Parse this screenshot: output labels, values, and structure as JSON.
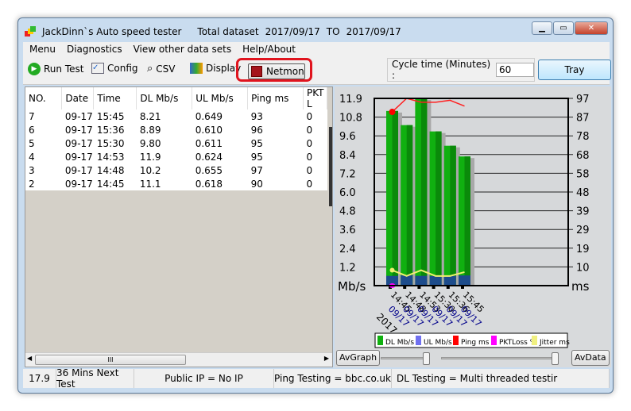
{
  "window": {
    "title": "JackDinn`s Auto speed tester",
    "dataset_label": "Total dataset",
    "date_from": "2017/09/17",
    "to_label": "TO",
    "date_to": "2017/09/17"
  },
  "menu": [
    "Menu",
    "Diagnostics",
    "View other data sets",
    "Help/About"
  ],
  "toolbar": {
    "run_test": "Run Test",
    "config": "Config",
    "csv": "CSV",
    "display": "Display",
    "netmon": "Netmon",
    "cycle_label": "Cycle time (Minutes) :",
    "cycle_value": "60",
    "tray": "Tray"
  },
  "table": {
    "headers": [
      "NO.",
      "Date",
      "Time",
      "DL Mb/s",
      "UL Mb/s",
      "Ping ms",
      "PKT L"
    ],
    "rows": [
      [
        "7",
        "09-17",
        "15:45",
        "8.21",
        "0.649",
        "93",
        "0"
      ],
      [
        "6",
        "09-17",
        "15:36",
        "8.89",
        "0.610",
        "96",
        "0"
      ],
      [
        "5",
        "09-17",
        "15:30",
        "9.80",
        "0.611",
        "95",
        "0"
      ],
      [
        "4",
        "09-17",
        "14:53",
        "11.9",
        "0.624",
        "95",
        "0"
      ],
      [
        "3",
        "09-17",
        "14:48",
        "10.2",
        "0.655",
        "97",
        "0"
      ],
      [
        "2",
        "09-17",
        "14:45",
        "11.1",
        "0.618",
        "90",
        "0"
      ]
    ],
    "scroll_thumb": "III"
  },
  "chart_data": {
    "type": "bar",
    "categories": [
      "14:45 09/17",
      "14:48 09/17",
      "14:53 09/17",
      "15:30 09/17",
      "15:36 09/17",
      "15:45 09/17"
    ],
    "times": [
      "14:45",
      "14:48",
      "14:53",
      "15:30",
      "15:36",
      "15:45"
    ],
    "dates": [
      "09/17",
      "09/17",
      "09/17",
      "09/17",
      "09/17",
      "09/17"
    ],
    "year": "2017",
    "ylabel": "Mb/s",
    "y2label": "ms",
    "ylim": [
      0,
      11.9
    ],
    "y2lim": [
      0,
      97
    ],
    "yticks": [
      "1.2",
      "2.4",
      "3.6",
      "4.8",
      "6.0",
      "7.2",
      "8.4",
      "9.6",
      "10.8",
      "11.9"
    ],
    "y2ticks": [
      "10",
      "19",
      "29",
      "39",
      "48",
      "58",
      "68",
      "78",
      "87",
      "97"
    ],
    "series": [
      {
        "name": "DL Mb/s",
        "values": [
          11.1,
          10.2,
          11.9,
          9.8,
          8.89,
          8.21
        ],
        "color": "#10b010"
      },
      {
        "name": "UL Mb/s",
        "values": [
          0.618,
          0.655,
          0.624,
          0.611,
          0.61,
          0.649
        ],
        "color": "#7070f0"
      },
      {
        "name": "Ping ms",
        "values": [
          90,
          97,
          95,
          95,
          96,
          93
        ],
        "color": "#ff0000"
      },
      {
        "name": "PKTLoss %",
        "values": [
          0,
          0,
          0,
          0,
          0,
          0
        ],
        "color": "#ff00ff"
      },
      {
        "name": "Jitter ms",
        "values": [
          8,
          5,
          8,
          5,
          5,
          7
        ],
        "color": "#f0f080"
      }
    ],
    "grid": true,
    "legend": "bottom"
  },
  "chart_buttons": {
    "avgraph": "AvGraph",
    "avdata": "AvData"
  },
  "status": [
    "17.9",
    "36 Mins Next Test",
    "Public IP = No IP",
    "Ping Testing = bbc.co.uk",
    "DL Testing = Multi threaded testir"
  ]
}
